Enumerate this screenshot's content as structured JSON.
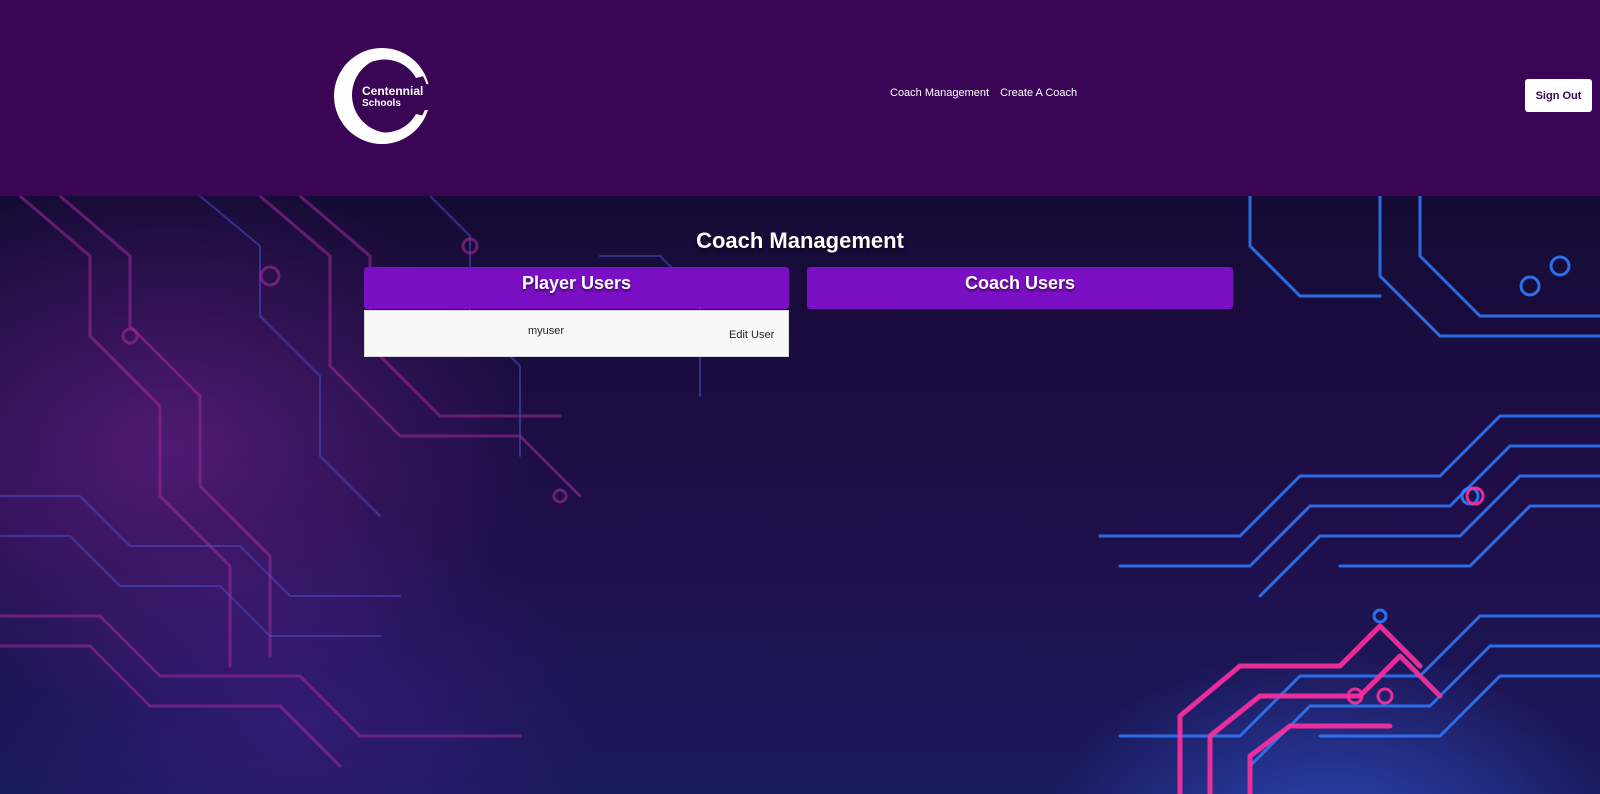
{
  "header": {
    "logo_text": [
      "Centennial",
      "Schools"
    ],
    "nav": [
      "Coach Management",
      "Create A Coach"
    ],
    "sign_out_label": "Sign Out"
  },
  "main": {
    "title": "Coach Management",
    "player_panel_title": "Player Users",
    "coach_panel_title": "Coach Users",
    "player_users": [
      {
        "name": "myuser",
        "action_label": "Edit User"
      }
    ]
  },
  "colors": {
    "header_bg": "#3a0555",
    "panel_header_bg": "#7b0fc4",
    "row_bg": "#f8f8f8"
  }
}
